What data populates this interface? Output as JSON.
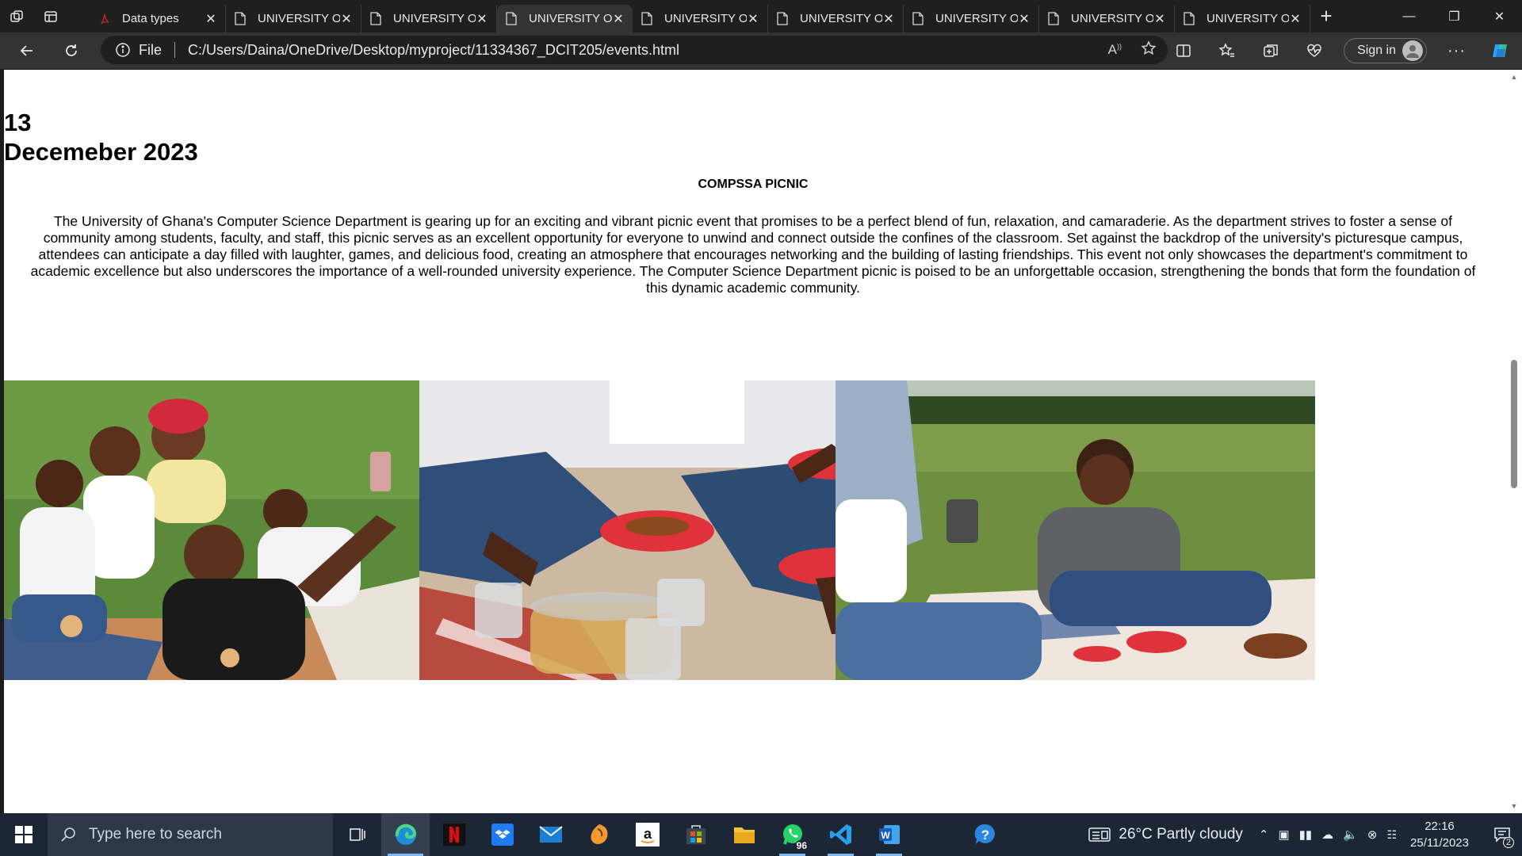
{
  "browser": {
    "tabs": [
      {
        "label": "Data types",
        "icon": "pdf-icon",
        "active": false
      },
      {
        "label": "UNIVERSITY OF GHANA",
        "icon": "file-icon",
        "active": false
      },
      {
        "label": "UNIVERSITY OF GHANA",
        "icon": "file-icon",
        "active": false
      },
      {
        "label": "UNIVERSITY OF GHANA",
        "icon": "file-icon",
        "active": true
      },
      {
        "label": "UNIVERSITY OF GHANA",
        "icon": "file-icon",
        "active": false
      },
      {
        "label": "UNIVERSITY OF GHANA",
        "icon": "file-icon",
        "active": false
      },
      {
        "label": "UNIVERSITY OF GHANA",
        "icon": "file-icon",
        "active": false
      },
      {
        "label": "UNIVERSITY OF GHANA",
        "icon": "file-icon",
        "active": false
      },
      {
        "label": "UNIVERSITY OF GHANA",
        "icon": "file-icon",
        "active": false
      }
    ],
    "address": {
      "scheme_label": "File",
      "url": "C:/Users/Daina/OneDrive/Desktop/myproject/11334367_DCIT205/events.html"
    },
    "signin_label": "Sign in"
  },
  "page": {
    "date_day": "13",
    "date_month_year": "Decemeber 2023",
    "event_title": "COMPSSA PICNIC",
    "event_description": "The University of Ghana's Computer Science Department is gearing up for an exciting and vibrant picnic event that promises to be a perfect blend of fun, relaxation, and camaraderie. As the department strives to foster a sense of community among students, faculty, and staff, this picnic serves as an excellent opportunity for everyone to unwind and connect outside the confines of the classroom. Set against the backdrop of the university's picturesque campus, attendees can anticipate a day filled with laughter, games, and delicious food, creating an atmosphere that encourages networking and the building of lasting friendships. This event not only showcases the department's commitment to academic excellence but also underscores the importance of a well-rounded university experience. The Computer Science Department picnic is poised to be an unforgettable occasion, strengthening the bonds that form the foundation of this dynamic academic community."
  },
  "taskbar": {
    "search_placeholder": "Type here to search",
    "whatsapp_badge": "96",
    "weather": "26°C  Partly cloudy",
    "time": "22:16",
    "date": "25/11/2023",
    "notification_count": "2"
  }
}
